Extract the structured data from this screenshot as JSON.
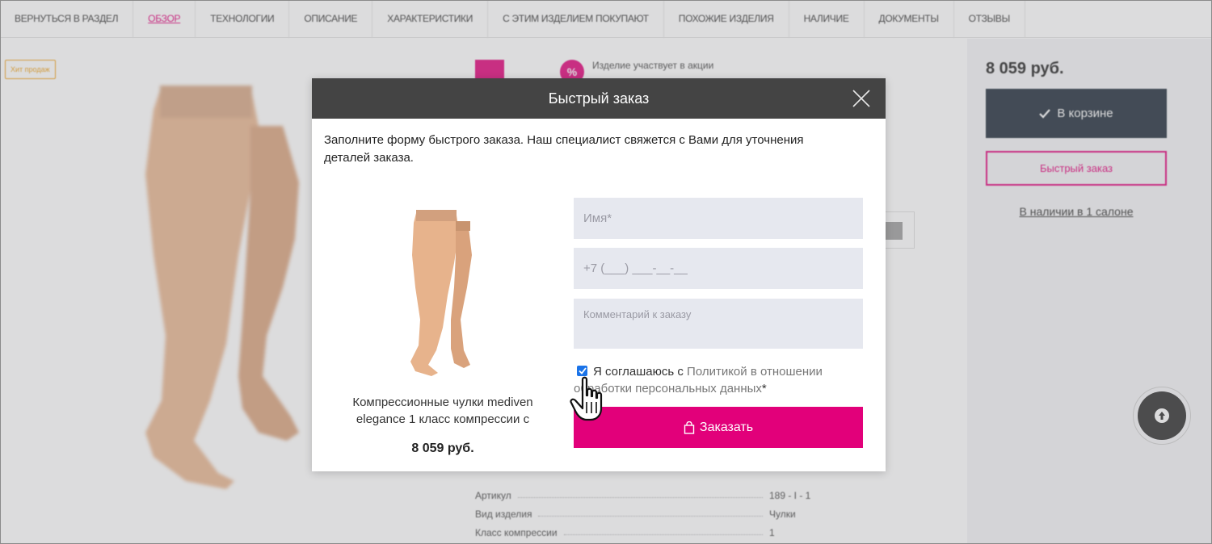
{
  "nav": {
    "items": [
      "Вернуться в раздел",
      "Обзор",
      "Технологии",
      "Описание",
      "Характеристики",
      "С этим изделием покупают",
      "Похожие изделия",
      "Наличие",
      "Документы",
      "Отзывы"
    ],
    "active_index": 1
  },
  "badge": "Хит продаж",
  "promo": {
    "icon": "%",
    "text": "Изделие участвует в акции"
  },
  "right_panel": {
    "price": "8 059 руб.",
    "cart_label": "В корзине",
    "quick_order_label": "Быстрый заказ",
    "availability_label": "В наличии в 1 салоне"
  },
  "specs": [
    {
      "name": "Артикул",
      "value": "189 - I - 1"
    },
    {
      "name": "Вид изделия",
      "value": "Чулки"
    },
    {
      "name": "Класс компрессии",
      "value": "1"
    }
  ],
  "modal": {
    "title": "Быстрый заказ",
    "intro": "Заполните форму быстрого заказа. Наш специалист свяжется с Вами для уточнения деталей заказа.",
    "product_name": "Компрессионные чулки mediven elegance 1 класс компрессии с",
    "product_price": "8 059 руб.",
    "fields": {
      "name_placeholder": "Имя*",
      "phone_placeholder": "+7 (___) ___-__-__",
      "comment_placeholder": "Комментарий к заказу"
    },
    "consent_checked": true,
    "consent_prefix": "Я соглашаюсь с ",
    "consent_link": "Политикой в отношении обработки персональных данных",
    "consent_suffix": "*",
    "order_button": "Заказать"
  },
  "colors": {
    "accent": "#e2007a",
    "header": "#444444",
    "cart_button": "#1e2a38",
    "field_bg": "#e6e8ef"
  },
  "icons": {
    "close": "close-icon",
    "bag": "shopping-bag-icon",
    "check": "check-icon",
    "scroll_top": "arrow-up-icon",
    "cursor": "hand-pointer-icon"
  }
}
